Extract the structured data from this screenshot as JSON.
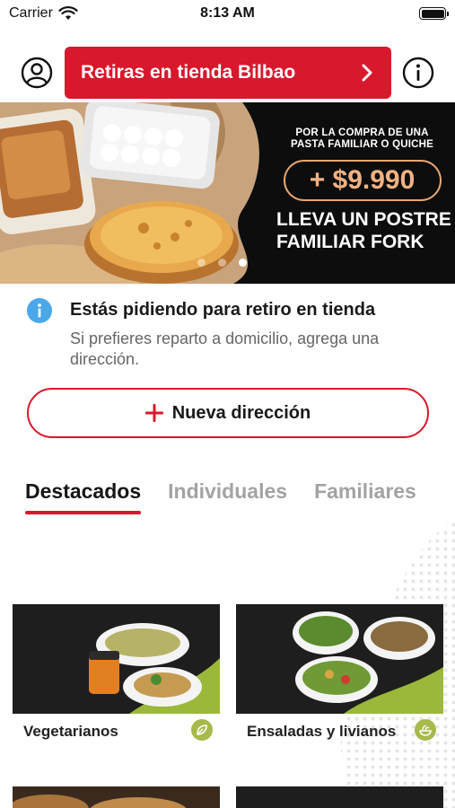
{
  "status_bar": {
    "carrier": "Carrier",
    "time": "8:13 AM",
    "icons": [
      "wifi-icon",
      "battery-icon"
    ]
  },
  "header": {
    "profile_icon": "user-circle-icon",
    "store_button_label": "Retiras en tienda Bilbao",
    "store_button_icon": "chevron-right-icon",
    "info_icon": "info-circle-icon",
    "accent_color": "#d8182c"
  },
  "banner": {
    "promo_line1": "POR LA COMPRA DE UNA",
    "promo_line2": "PASTA FAMILIAR O QUICHE",
    "price": "+ $9.990",
    "headline_line1": "LLEVA UN POSTRE",
    "headline_line2": "FAMILIAR FORK",
    "carousel_total": 3,
    "carousel_active": 3
  },
  "pickup_notice": {
    "icon": "info-icon",
    "title": "Estás pidiendo para retiro en tienda",
    "subtitle": "Si prefieres reparto a domicilio, agrega una dirección."
  },
  "new_address_button": {
    "icon": "plus-icon",
    "label": "Nueva dirección"
  },
  "tabs": [
    {
      "label": "Destacados",
      "active": true
    },
    {
      "label": "Individuales",
      "active": false
    },
    {
      "label": "Familiares",
      "active": false
    }
  ],
  "categories": [
    {
      "label": "Vegetarianos",
      "icon": "leaf-icon"
    },
    {
      "label": "Ensaladas y livianos",
      "icon": "salad-icon"
    }
  ]
}
